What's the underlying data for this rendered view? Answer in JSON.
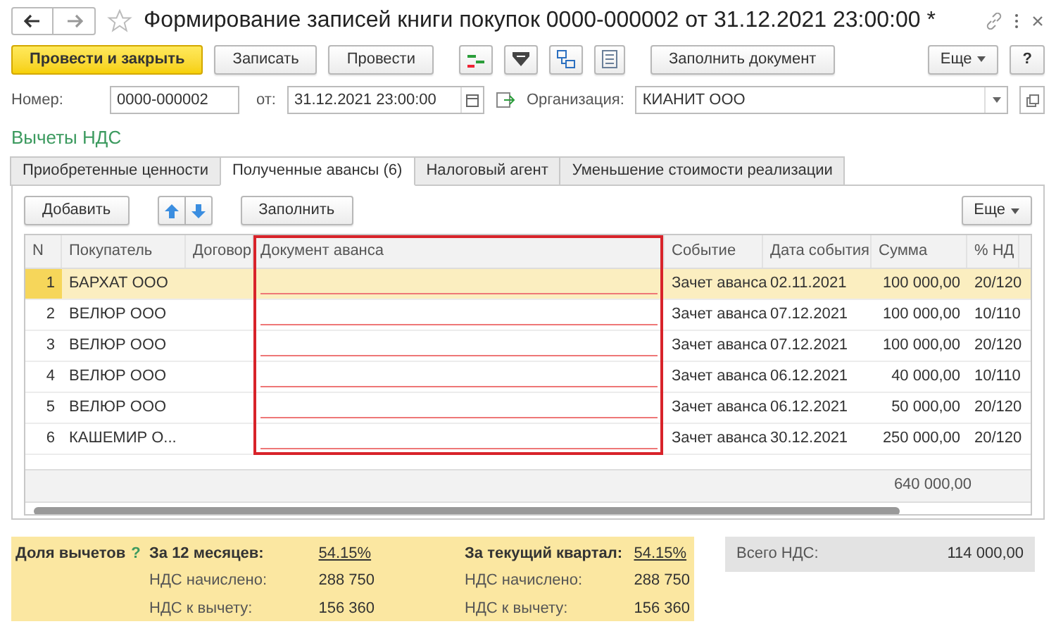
{
  "window": {
    "title": "Формирование записей книги покупок 0000-000002 от 31.12.2021 23:00:00 *",
    "favorite": false
  },
  "toolbar": {
    "buttons": [
      {
        "label": "Провести и закрыть",
        "kind": "primary"
      },
      {
        "label": "Записать",
        "kind": "normal"
      },
      {
        "label": "Провести",
        "kind": "normal"
      },
      {
        "label": "Заполнить документ",
        "kind": "normal"
      }
    ],
    "more": "Еще",
    "help": "?"
  },
  "fields": {
    "number_label": "Номер:",
    "number": "0000-000002",
    "date_label": "от:",
    "date": "31.12.2021 23:00:00",
    "org_label": "Организация:",
    "org": "КИАНИТ ООО"
  },
  "section_title": "Вычеты НДС",
  "tabs": [
    {
      "label": "Приобретенные ценности",
      "selected": false
    },
    {
      "label": "Полученные авансы (6)",
      "selected": true
    },
    {
      "label": "Налоговый агент",
      "selected": false
    },
    {
      "label": "Уменьшение стоимости реализации",
      "selected": false
    }
  ],
  "table_toolbar": {
    "add": "Добавить",
    "fill": "Заполнить",
    "more": "Еще"
  },
  "table": {
    "columns": [
      "N",
      "Покупатель",
      "Договор",
      "Документ аванса",
      "Событие",
      "Дата события",
      "Сумма",
      "% НД"
    ],
    "rows": [
      {
        "n": "1",
        "buyer": "БАРХАТ ООО",
        "event": "Зачет аванса",
        "date": "02.11.2021",
        "sum": "100 000,00",
        "rate": "20/120",
        "selected": true,
        "doc_missing": true
      },
      {
        "n": "2",
        "buyer": "ВЕЛЮР ООО",
        "event": "Зачет аванса",
        "date": "07.12.2021",
        "sum": "100 000,00",
        "rate": "10/110",
        "selected": false,
        "doc_missing": true
      },
      {
        "n": "3",
        "buyer": "ВЕЛЮР ООО",
        "event": "Зачет аванса",
        "date": "07.12.2021",
        "sum": "100 000,00",
        "rate": "20/120",
        "selected": false,
        "doc_missing": true
      },
      {
        "n": "4",
        "buyer": "ВЕЛЮР ООО",
        "event": "Зачет аванса",
        "date": "06.12.2021",
        "sum": "40 000,00",
        "rate": "10/110",
        "selected": false,
        "doc_missing": true
      },
      {
        "n": "5",
        "buyer": "ВЕЛЮР ООО",
        "event": "Зачет аванса",
        "date": "06.12.2021",
        "sum": "50 000,00",
        "rate": "20/120",
        "selected": false,
        "doc_missing": true
      },
      {
        "n": "6",
        "buyer": "КАШЕМИР О...",
        "event": "Зачет аванса",
        "date": "30.12.2021",
        "sum": "250 000,00",
        "rate": "20/120",
        "selected": false,
        "doc_missing": true
      }
    ],
    "total": "640 000,00"
  },
  "summary": {
    "label": "Доля вычетов",
    "hint": "?",
    "periods": [
      {
        "title": "За 12 месяцев:",
        "percent": "54.15%",
        "accrued_label": "НДС начислено:",
        "accrued": "288 750",
        "deduct_label": "НДС к вычету:",
        "deduct": "156 360"
      },
      {
        "title": "За текущий квартал:",
        "percent": "54.15%",
        "accrued_label": "НДС начислено:",
        "accrued": "288 750",
        "deduct_label": "НДС к вычету:",
        "deduct": "156 360"
      }
    ],
    "total_label": "Всего НДС:",
    "total": "114 000,00"
  }
}
